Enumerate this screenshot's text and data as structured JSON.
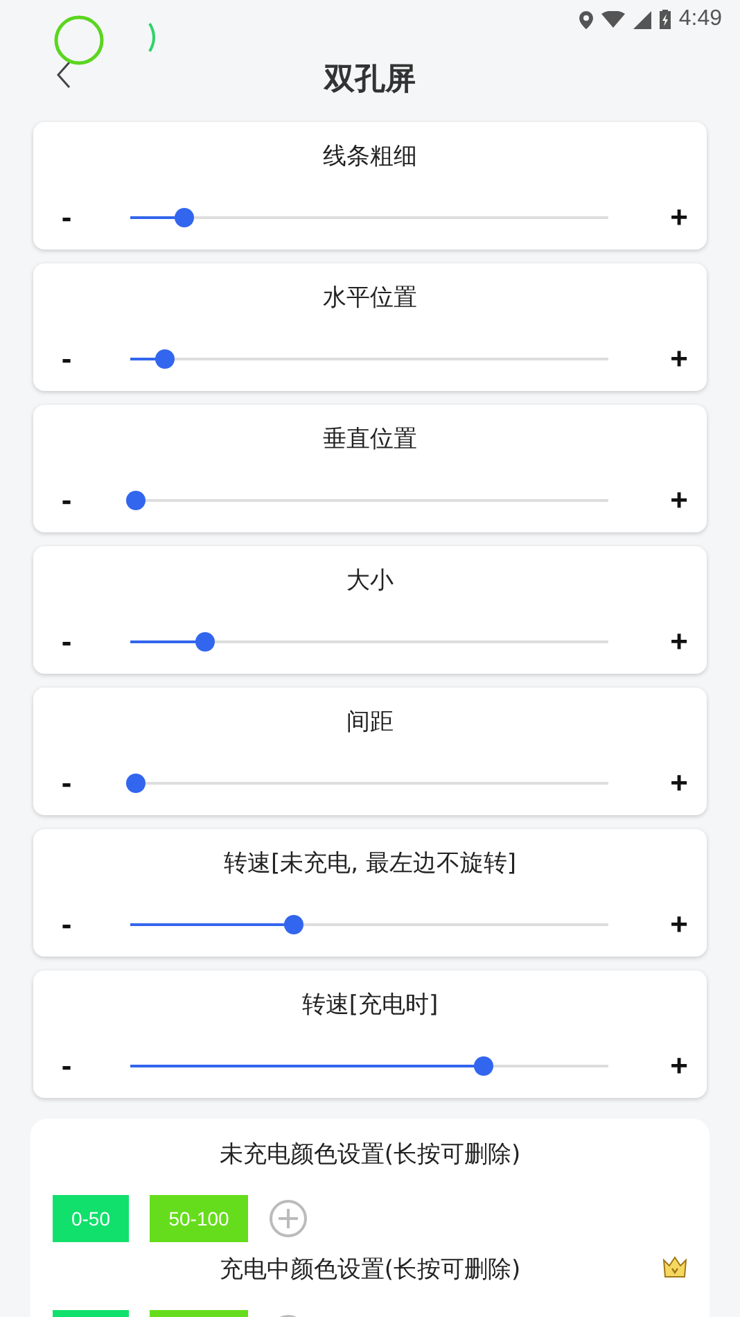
{
  "status_bar": {
    "time": "4:49"
  },
  "header": {
    "title": "双孔屏"
  },
  "sliders": [
    {
      "label": "线条粗细",
      "minus": "-",
      "plus": "+",
      "level": 0.11
    },
    {
      "label": "水平位置",
      "minus": "-",
      "plus": "+",
      "level": 0.07
    },
    {
      "label": "垂直位置",
      "minus": "-",
      "plus": "+",
      "level": 0.01
    },
    {
      "label": "大小",
      "minus": "-",
      "plus": "+",
      "level": 0.15
    },
    {
      "label": "间距",
      "minus": "-",
      "plus": "+",
      "level": 0.01
    },
    {
      "label": "转速[未充电, 最左边不旋转]",
      "minus": "-",
      "plus": "+",
      "level": 0.33
    },
    {
      "label": "转速[充电时]",
      "minus": "-",
      "plus": "+",
      "level": 0.71
    }
  ],
  "color_settings": [
    {
      "title": "未充电颜色设置(长按可删除)",
      "premium": false,
      "swatches": [
        {
          "label": "0-50",
          "color": "#12e06c"
        },
        {
          "label": "50-100",
          "color": "#66dd1c"
        }
      ]
    },
    {
      "title": "充电中颜色设置(长按可删除)",
      "premium": true,
      "swatches": [
        {
          "color": "#12e06c"
        },
        {
          "color": "#66dd1c"
        }
      ]
    }
  ]
}
